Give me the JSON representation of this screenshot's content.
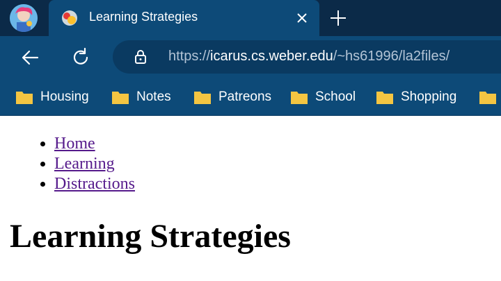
{
  "browser": {
    "tab": {
      "title": "Learning Strategies"
    },
    "address_bar": {
      "scheme": "https://",
      "host": "icarus.cs.weber.edu",
      "path": "/~hs61996/la2files/"
    },
    "bookmarks": [
      {
        "label": "Housing",
        "icon": "folder-icon"
      },
      {
        "label": "Notes",
        "icon": "folder-icon"
      },
      {
        "label": "Patreons",
        "icon": "folder-icon"
      },
      {
        "label": "School",
        "icon": "folder-icon"
      },
      {
        "label": "Shopping",
        "icon": "folder-icon"
      }
    ],
    "colors": {
      "tabstrip": "#0b2a48",
      "toolbar": "#0d4a78",
      "omnibox": "#0a3a61",
      "folder": "#f4c542"
    }
  },
  "page": {
    "nav_links": [
      "Home",
      "Learning",
      "Distractions"
    ],
    "heading": "Learning Strategies",
    "link_color": "#551a8b"
  }
}
